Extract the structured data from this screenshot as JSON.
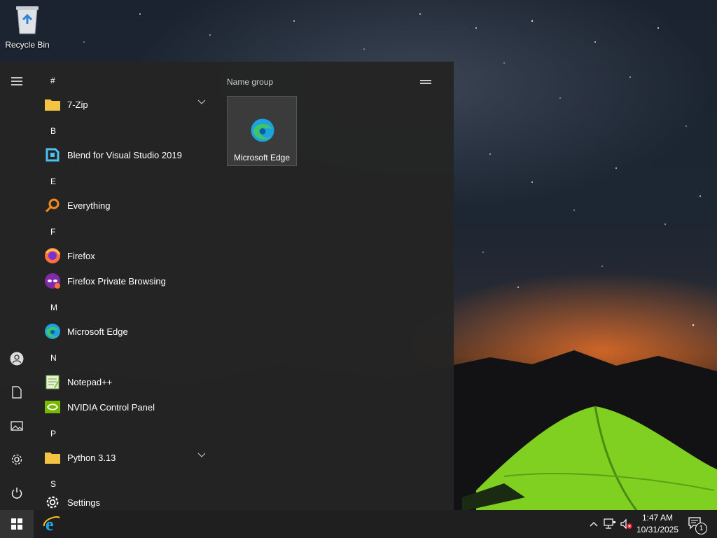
{
  "desktop": {
    "recycle_bin_label": "Recycle Bin"
  },
  "start_menu": {
    "groups": [
      {
        "header": "#",
        "apps": [
          {
            "label": "7-Zip",
            "icon": "folder-icon",
            "expandable": true
          }
        ]
      },
      {
        "header": "B",
        "apps": [
          {
            "label": "Blend for Visual Studio 2019",
            "icon": "blend-icon"
          }
        ]
      },
      {
        "header": "E",
        "apps": [
          {
            "label": "Everything",
            "icon": "everything-search-icon"
          }
        ]
      },
      {
        "header": "F",
        "apps": [
          {
            "label": "Firefox",
            "icon": "firefox-icon"
          },
          {
            "label": "Firefox Private Browsing",
            "icon": "firefox-private-icon"
          }
        ]
      },
      {
        "header": "M",
        "apps": [
          {
            "label": "Microsoft Edge",
            "icon": "edge-icon"
          }
        ]
      },
      {
        "header": "N",
        "apps": [
          {
            "label": "Notepad++",
            "icon": "notepadpp-icon"
          },
          {
            "label": "NVIDIA Control Panel",
            "icon": "nvidia-icon"
          }
        ]
      },
      {
        "header": "P",
        "apps": [
          {
            "label": "Python 3.13",
            "icon": "folder-icon",
            "expandable": true
          }
        ]
      },
      {
        "header": "S",
        "apps": [
          {
            "label": "Settings",
            "icon": "gear-icon"
          }
        ]
      }
    ],
    "tile_group": {
      "name": "Name group",
      "tiles": [
        {
          "label": "Microsoft Edge",
          "icon": "edge-icon"
        }
      ]
    }
  },
  "taskbar": {
    "pinned": [
      {
        "name": "internet-explorer-icon"
      }
    ],
    "clock": {
      "time": "1:47 AM",
      "date": "10/31/2025"
    },
    "notifications_count": "1"
  },
  "colors": {
    "start_menu_bg": "#242424",
    "taskbar_bg": "#1f1f1f",
    "folder_yellow": "#f4c343",
    "tent_green": "#8ee028"
  }
}
